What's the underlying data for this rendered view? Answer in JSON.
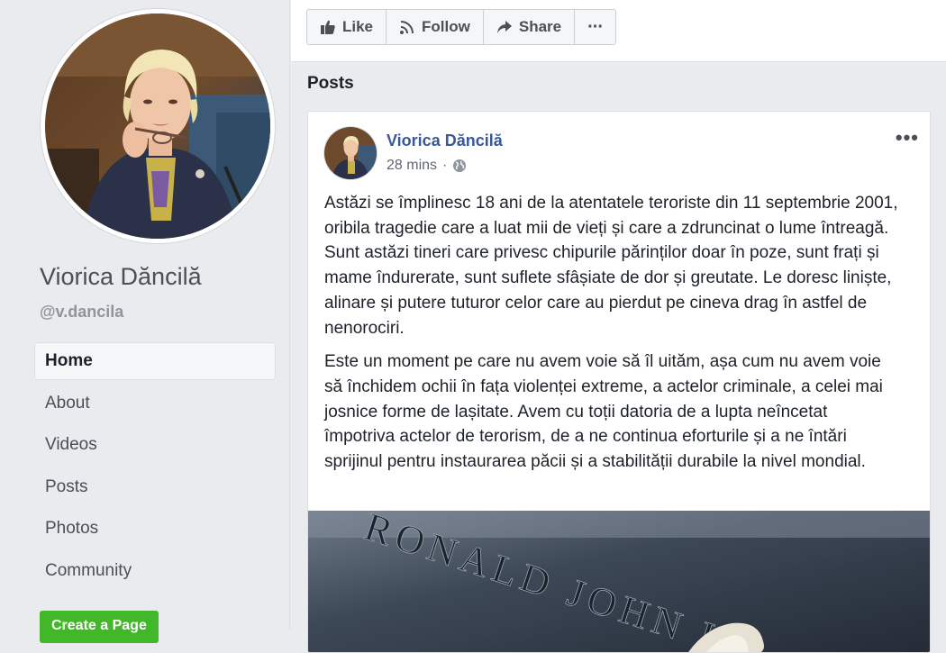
{
  "profile": {
    "name": "Viorica Dăncilă",
    "handle": "@v.dancila"
  },
  "nav": {
    "items": [
      {
        "label": "Home",
        "active": true
      },
      {
        "label": "About"
      },
      {
        "label": "Videos"
      },
      {
        "label": "Posts"
      },
      {
        "label": "Photos"
      },
      {
        "label": "Community"
      }
    ],
    "create_page_label": "Create a Page"
  },
  "actions": {
    "like_label": "Like",
    "follow_label": "Follow",
    "share_label": "Share",
    "more_label": "···"
  },
  "posts_heading": "Posts",
  "post": {
    "author": "Viorica Dăncilă",
    "time": "28 mins",
    "separator": "·",
    "menu_label": "•••",
    "paragraph_1": "Astăzi se împlinesc 18 ani de la atentatele teroriste din 11 septembrie 2001, oribila tragedie care a luat mii de vieți și care a zdruncinat o lume întreagă. Sunt astăzi tineri care privesc chipurile părinților doar în poze, sunt frați și mame îndurerate, sunt suflete sfâșiate de dor și greutate. Le doresc liniște, alinare și putere tuturor celor care au pierdut pe cineva drag în astfel de nenorociri.",
    "paragraph_2": "Este un moment pe care nu avem voie să îl uităm, așa cum nu avem voie să închidem ochii în fața violenței extreme, a actelor criminale, a celei mai josnice forme de lașitate. Avem cu toții datoria de a lupta neîncetat împotriva actelor de terorism, de a ne continua eforturile și a ne întări sprijinul pentru instaurarea păcii și a stabilității durabile la nivel mondial.",
    "photo_engraving": "RONALD JOHN HE"
  },
  "colors": {
    "link_blue": "#385898",
    "create_green": "#42b72a",
    "page_bg": "#e9ebee"
  }
}
